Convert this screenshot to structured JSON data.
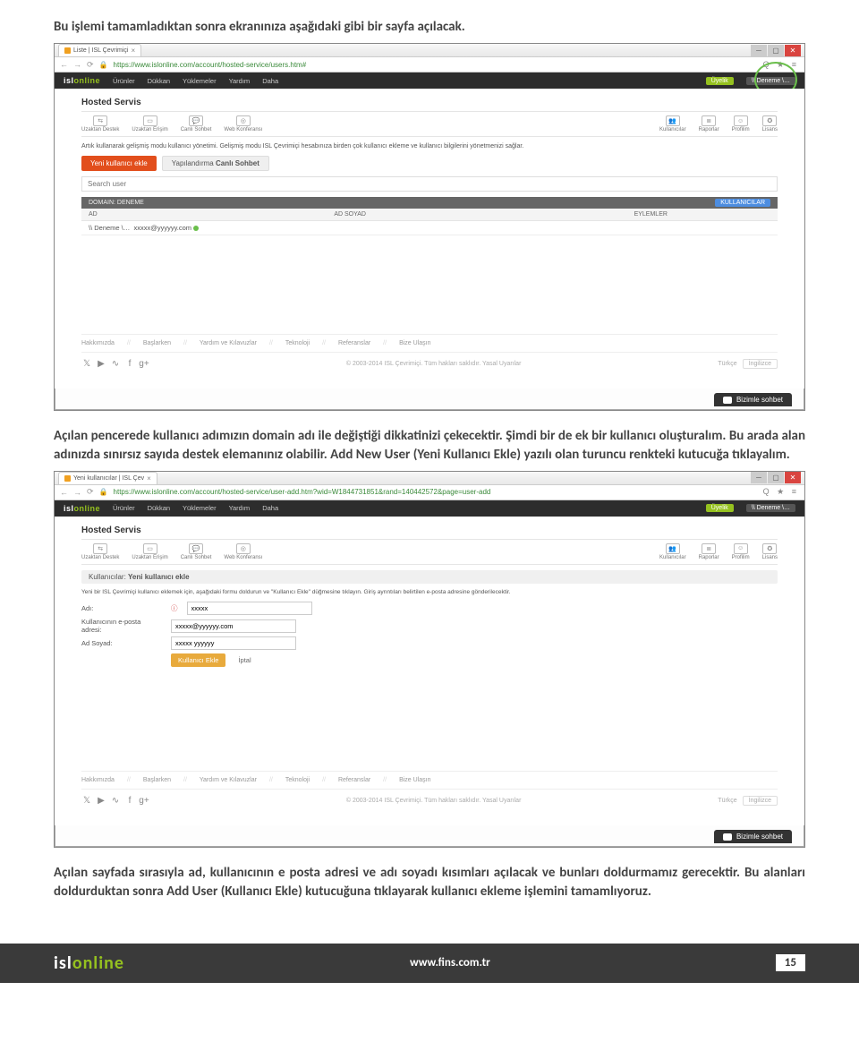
{
  "text": {
    "p1": "Bu işlemi tamamladıktan sonra ekranınıza aşağıdaki gibi bir sayfa açılacak.",
    "p2": "Açılan pencerede kullanıcı adımızın domain adı ile değiştiği dikkatinizi çekecektir. Şimdi bir de ek bir kullanıcı oluşturalım. Bu arada alan adınızda sınırsız sayıda destek elemanınız olabilir. Add New User (Yeni Kullanıcı Ekle) yazılı olan turuncu renkteki kutucuğa tıklayalım.",
    "p3": "Açılan sayfada sırasıyla ad, kullanıcının e posta adresi ve adı soyadı kısımları açılacak ve bunları doldurmamız gerecektir. Bu alanları doldurduktan sonra Add User (Kullanıcı Ekle) kutucuğuna tıklayarak kullanıcı ekleme işlemini tamamlıyoruz."
  },
  "shot1": {
    "tabTitle": "Liste | ISL Çevrimiçi",
    "url": "https://www.islonline.com/account/hosted-service/users.htm#",
    "topnav": [
      "Ürünler",
      "Dükkan",
      "Yüklemeler",
      "Yardım",
      "Daha"
    ],
    "member": "Üyelik",
    "user": "\\\\ Deneme \\…",
    "heading": "Hosted Servis",
    "toolsLeft": [
      "Uzaktan Destek",
      "Uzaktan Erişim",
      "Canlı Sohbet",
      "Web Konferansı"
    ],
    "toolsRight": [
      "Kullanıcılar",
      "Raporlar",
      "Profilim",
      "Lisans"
    ],
    "info": "Artık kullanarak gelişmiş modu kullanıcı yönetimi. Gelişmiş modu ISL Çevrimiçi hesabınıza birden çok kullanıcı ekleme ve kullanıcı bilgilerini yönetmenizi sağlar.",
    "btnAdd": "Yeni kullanıcı ekle",
    "btnConf": "Yapılandırma",
    "btnConfBold": "Canlı Sohbet",
    "searchPlaceholder": "Search user",
    "barTitle": "DOMAIN: DENEME",
    "barChip": "KULLANICILAR",
    "colAd": "AD",
    "colName": "AD SOYAD",
    "colAct": "EYLEMLER",
    "rowDomain": "\\\\ Deneme \\…",
    "rowEmail": "xxxxx@yyyyyy.com",
    "flinks": [
      "Hakkımızda",
      "Başlarken",
      "Yardım ve Kılavuzlar",
      "Teknoloji",
      "Referanslar",
      "Bize Ulaşın"
    ],
    "copyright": "© 2003-2014 ISL Çevrimiçi. Tüm hakları saklıdır. Yasal Uyarılar",
    "langLabel": "Türkçe",
    "langSel": "İngilizce",
    "chat": "Bizimle sohbet"
  },
  "shot2": {
    "tabTitle": "Yeni kullanıcılar | ISL Çev",
    "url": "https://www.islonline.com/account/hosted-service/user-add.htm?wid=W1844731851&rand=140442572&page=user-add",
    "topnav": [
      "Ürünler",
      "Dükkan",
      "Yüklemeler",
      "Yardım",
      "Daha"
    ],
    "member": "Üyelik",
    "user": "\\\\ Deneme \\…",
    "heading": "Hosted Servis",
    "toolsLeft": [
      "Uzaktan Destek",
      "Uzaktan Erişim",
      "Canlı Sohbet",
      "Web Konferansı"
    ],
    "toolsRight": [
      "Kullanıcılar",
      "Raporlar",
      "Profilim",
      "Lisans"
    ],
    "crumbPre": "Kullanıcılar:",
    "crumbBold": "Yeni kullanıcı ekle",
    "info": "Yeni bir ISL Çevrimiçi kullanıcı eklemek için, aşağıdaki formu doldurun ve \"Kullanıcı Ekle\" düğmesine tıklayın. Giriş ayrıntıları belirtilen e-posta adresine gönderilecektir.",
    "labName": "Adı:",
    "valName": "xxxxx",
    "labEmail": "Kullanıcının e-posta adresi:",
    "valEmail": "xxxxx@yyyyyy.com",
    "labFull": "Ad Soyad:",
    "valFull": "xxxxx yyyyyy",
    "btnSubmit": "Kullanıcı Ekle",
    "btnCancel": "İptal",
    "flinks": [
      "Hakkımızda",
      "Başlarken",
      "Yardım ve Kılavuzlar",
      "Teknoloji",
      "Referanslar",
      "Bize Ulaşın"
    ],
    "copyright": "© 2003-2014 ISL Çevrimiçi. Tüm hakları saklıdır. Yasal Uyarılar",
    "langLabel": "Türkçe",
    "langSel": "İngilizce",
    "chat": "Bizimle sohbet"
  },
  "footer": {
    "brand1": "isl",
    "brand2": "online",
    "url": "www.fins.com.tr",
    "page": "15"
  }
}
